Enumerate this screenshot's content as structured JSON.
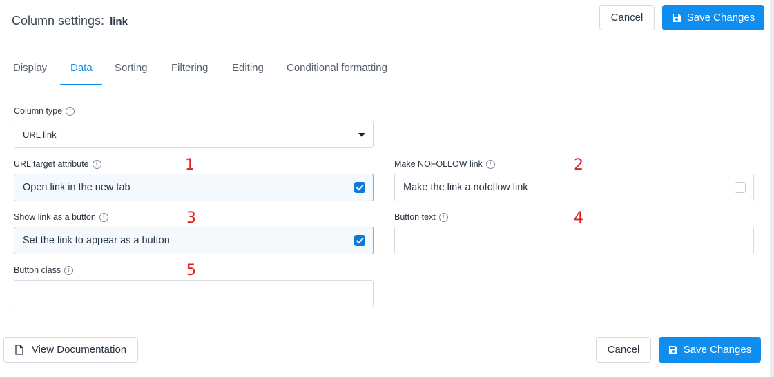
{
  "header": {
    "title_prefix": "Column settings:",
    "column_name": "link",
    "cancel_label": "Cancel",
    "save_label": "Save Changes"
  },
  "tabs": [
    {
      "label": "Display",
      "active": false
    },
    {
      "label": "Data",
      "active": true
    },
    {
      "label": "Sorting",
      "active": false
    },
    {
      "label": "Filtering",
      "active": false
    },
    {
      "label": "Editing",
      "active": false
    },
    {
      "label": "Conditional formatting",
      "active": false
    }
  ],
  "form": {
    "column_type": {
      "label": "Column type",
      "value": "URL link"
    },
    "url_target": {
      "label": "URL target attribute",
      "option": "Open link in the new tab",
      "checked": true,
      "marker": "1"
    },
    "nofollow": {
      "label": "Make NOFOLLOW link",
      "option": "Make the link a nofollow link",
      "checked": false,
      "marker": "2"
    },
    "link_as_button": {
      "label": "Show link as a button",
      "option": "Set the link to appear as a button",
      "checked": true,
      "marker": "3"
    },
    "button_text": {
      "label": "Button text",
      "value": "",
      "marker": "4"
    },
    "button_class": {
      "label": "Button class",
      "value": "",
      "marker": "5"
    }
  },
  "footer": {
    "docs_label": "View Documentation",
    "cancel_label": "Cancel",
    "save_label": "Save Changes"
  },
  "icons": {
    "info": "info-icon",
    "save": "floppy-disk-icon",
    "docs": "document-icon",
    "caret": "caret-down-icon",
    "checkbox": "checkbox-icon"
  },
  "colors": {
    "primary": "#0f8ef0",
    "checkbox_on": "#1178d6",
    "marker": "#e02020"
  }
}
